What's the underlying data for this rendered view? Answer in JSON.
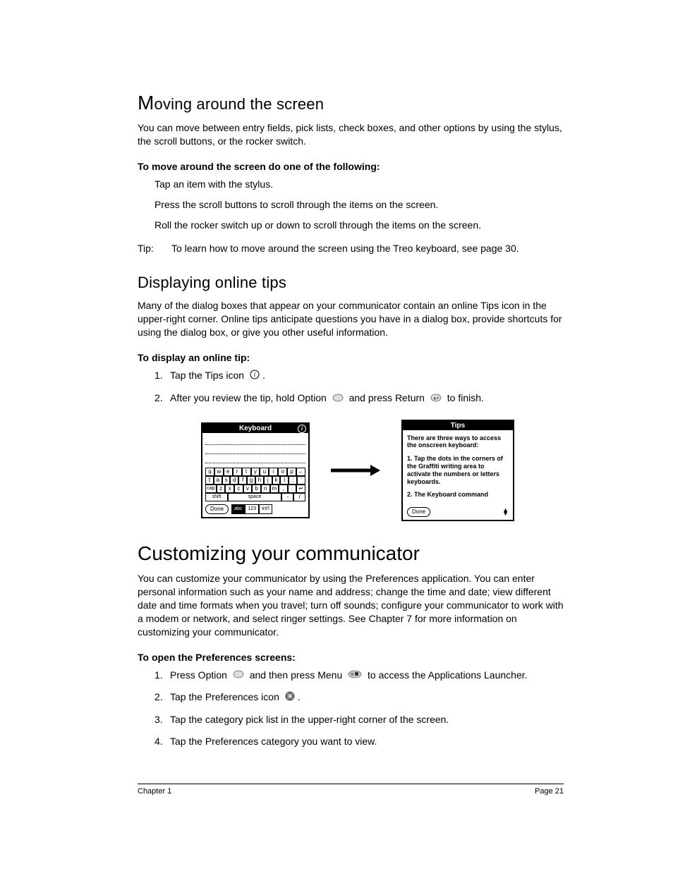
{
  "section1": {
    "heading": "Moving around the screen",
    "dropcap": "M",
    "heading_rest": "oving around the screen",
    "intro": "You can move between entry fields, pick lists, check boxes, and other options by using the stylus, the scroll buttons, or the rocker switch.",
    "sub_bold": "To move around the screen do one of the following:",
    "items": [
      "Tap an item with the stylus.",
      "Press the scroll buttons to scroll through the items on the screen.",
      "Roll the rocker switch up or down to scroll through the items on the screen."
    ],
    "tip_label": "Tip:",
    "tip_text": "To learn how to move around the screen using the Treo keyboard, see page 30."
  },
  "section2": {
    "heading": "Displaying online tips",
    "intro": "Many of the dialog boxes that appear on your communicator contain an online Tips icon in the upper-right corner. Online tips anticipate questions you have in a dialog box, provide shortcuts for using the dialog box, or give you other useful information.",
    "sub_bold": "To display an online tip:",
    "step1_marker": "1.",
    "step1_a": "Tap the Tips icon ",
    "step1_b": ".",
    "step2_marker": "2.",
    "step2_a": "After you review the tip, hold Option ",
    "step2_b": " and press Return ",
    "step2_c": " to finish."
  },
  "diagram": {
    "kbd_title": "Keyboard",
    "info_i": "i",
    "row1": [
      "q",
      "w",
      "e",
      "r",
      "t",
      "y",
      "u",
      "i",
      "o",
      "p",
      "←"
    ],
    "row2": [
      "⇧",
      "a",
      "s",
      "d",
      "f",
      "g",
      "h",
      "j",
      "k",
      "l",
      ";",
      "'"
    ],
    "row3": [
      "cap",
      "z",
      "x",
      "c",
      "v",
      "b",
      "n",
      "m",
      ",",
      ".",
      "↵"
    ],
    "shift": "shift",
    "space": "space",
    "done": "Done",
    "seg": [
      "abc",
      "123",
      "Int'l"
    ],
    "tips_title": "Tips",
    "tips_p1": "There are three ways to access the onscreen keyboard:",
    "tips_p2": "1. Tap the dots in the corners of the Graffiti writing area to activate the numbers or letters keyboards.",
    "tips_p3": "2. The Keyboard command",
    "tips_done": "Done"
  },
  "section3": {
    "heading": "Customizing your communicator",
    "intro": "You can customize your communicator by using the Preferences application. You can enter personal information such as your name and address; change the time and date; view different date and time formats when you travel; turn off sounds; configure your communicator to work with a modem or network, and select ringer settings. See Chapter 7 for more information on customizing your communicator.",
    "sub_bold": "To open the Preferences screens:",
    "s1_marker": "1.",
    "s1_a": "Press Option ",
    "s1_b": " and then press Menu ",
    "s1_c": " to access the Applications Launcher.",
    "s2_marker": "2.",
    "s2_a": "Tap the Preferences icon ",
    "s2_b": ".",
    "s3_marker": "3.",
    "s3": "Tap the category pick list in the upper-right corner of the screen.",
    "s4_marker": "4.",
    "s4": "Tap the Preferences category you want to view."
  },
  "footer": {
    "left": "Chapter 1",
    "right": "Page 21"
  }
}
